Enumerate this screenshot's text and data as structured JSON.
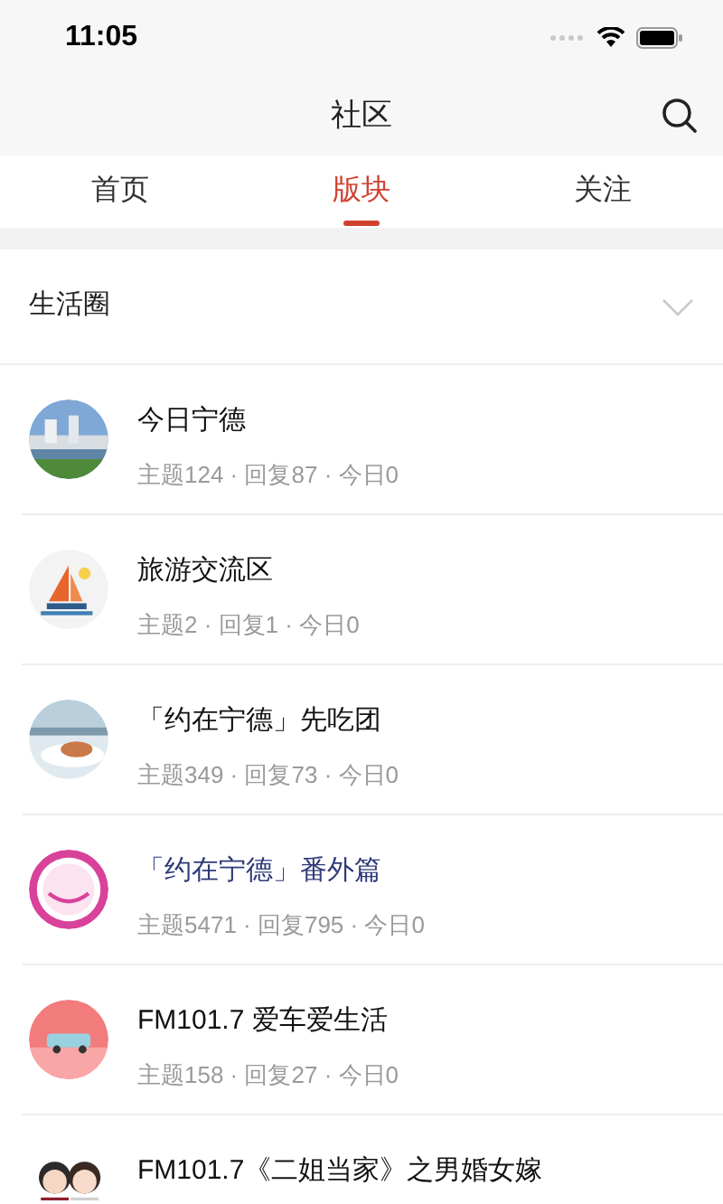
{
  "status_bar": {
    "time": "11:05"
  },
  "nav": {
    "title": "社区"
  },
  "tabs": [
    {
      "label": "首页",
      "selected": false
    },
    {
      "label": "版块",
      "selected": true
    },
    {
      "label": "关注",
      "selected": false
    }
  ],
  "group": {
    "title": "生活圈",
    "expanded": false
  },
  "forums": [
    {
      "title": "今日宁德",
      "stats": "主题124 · 回复87 · 今日0",
      "visited": false
    },
    {
      "title": "旅游交流区",
      "stats": "主题2 · 回复1 · 今日0",
      "visited": false
    },
    {
      "title": "「约在宁德」先吃团",
      "stats": "主题349 · 回复73 · 今日0",
      "visited": false
    },
    {
      "title": "「约在宁德」番外篇",
      "stats": "主题5471 · 回复795 · 今日0",
      "visited": true
    },
    {
      "title": "FM101.7 爱车爱生活",
      "stats": "主题158 · 回复27 · 今日0",
      "visited": false
    },
    {
      "title": "FM101.7《二姐当家》之男婚女嫁",
      "visited": false
    }
  ]
}
